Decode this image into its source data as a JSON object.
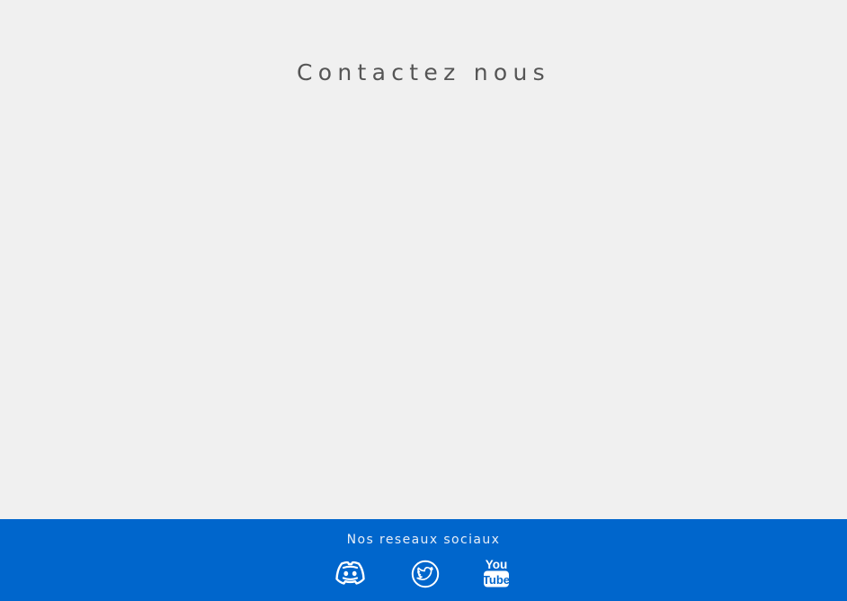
{
  "page": {
    "title": "Contactez nous",
    "background_color": "#f0f0f0"
  },
  "footer": {
    "title": "Nos reseaux sociaux",
    "background_color": "#0066cc",
    "social_links": [
      {
        "icon": "discord-icon"
      },
      {
        "icon": "twitter-icon"
      },
      {
        "icon": "youtube-icon"
      }
    ]
  }
}
